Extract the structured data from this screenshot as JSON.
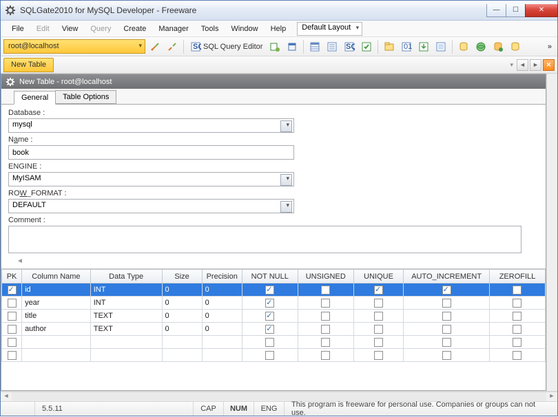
{
  "window": {
    "title": "SQLGate2010 for MySQL Developer - Freeware"
  },
  "menu": {
    "file": "File",
    "edit": "Edit",
    "view": "View",
    "query": "Query",
    "create": "Create",
    "manager": "Manager",
    "tools": "Tools",
    "window": "Window",
    "help": "Help",
    "layout": "Default Layout"
  },
  "toolbar": {
    "connection": "root@localhost",
    "sql_editor": "SQL Query Editor"
  },
  "tabbar": {
    "active_tab": "New Table"
  },
  "panel": {
    "title": "New Table - root@localhost",
    "tabs": {
      "general": "General",
      "table_options": "Table Options"
    }
  },
  "form": {
    "database_label": "Database :",
    "database_value": "mysql",
    "name_label_pre": "N",
    "name_label_ul": "a",
    "name_label_post": "me :",
    "name_value": "book",
    "engine_label": "ENGINE :",
    "engine_value": "MyISAM",
    "rowformat_label_pre": "RO",
    "rowformat_label_ul": "W",
    "rowformat_label_post": "_FORMAT :",
    "rowformat_value": "DEFAULT",
    "comment_label": "Comment :"
  },
  "grid": {
    "headers": {
      "pk": "PK",
      "name": "Column Name",
      "type": "Data Type",
      "size": "Size",
      "prec": "Precision",
      "nn": "NOT NULL",
      "un": "UNSIGNED",
      "uq": "UNIQUE",
      "ai": "AUTO_INCREMENT",
      "zf": "ZEROFILL"
    },
    "rows": [
      {
        "pk": true,
        "name": "id",
        "type": "INT",
        "size": "0",
        "prec": "0",
        "nn": true,
        "un": false,
        "uq": true,
        "ai": true,
        "zf": false,
        "selected": true
      },
      {
        "pk": false,
        "name": "year",
        "type": "INT",
        "size": "0",
        "prec": "0",
        "nn": true,
        "un": false,
        "uq": false,
        "ai": false,
        "zf": false
      },
      {
        "pk": false,
        "name": "title",
        "type": "TEXT",
        "size": "0",
        "prec": "0",
        "nn": true,
        "un": false,
        "uq": false,
        "ai": false,
        "zf": false
      },
      {
        "pk": false,
        "name": "author",
        "type": "TEXT",
        "size": "0",
        "prec": "0",
        "nn": true,
        "un": false,
        "uq": false,
        "ai": false,
        "zf": false
      },
      {
        "pk": false,
        "name": "",
        "type": "",
        "size": "",
        "prec": "",
        "nn": false,
        "un": false,
        "uq": false,
        "ai": false,
        "zf": false
      },
      {
        "pk": false,
        "name": "",
        "type": "",
        "size": "",
        "prec": "",
        "nn": false,
        "un": false,
        "uq": false,
        "ai": false,
        "zf": false
      }
    ]
  },
  "statusbar": {
    "version": "5.5.11",
    "cap": "CAP",
    "num": "NUM",
    "eng": "ENG",
    "msg": "This program is freeware for personal use. Companies or groups can not use."
  }
}
